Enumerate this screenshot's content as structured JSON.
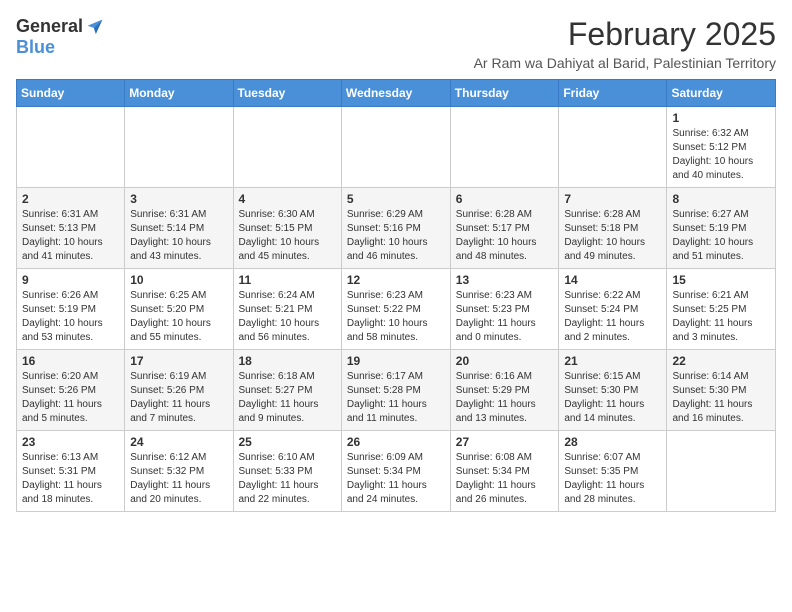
{
  "header": {
    "logo_general": "General",
    "logo_blue": "Blue",
    "month_title": "February 2025",
    "location": "Ar Ram wa Dahiyat al Barid, Palestinian Territory"
  },
  "days_of_week": [
    "Sunday",
    "Monday",
    "Tuesday",
    "Wednesday",
    "Thursday",
    "Friday",
    "Saturday"
  ],
  "weeks": [
    [
      {
        "day": "",
        "info": ""
      },
      {
        "day": "",
        "info": ""
      },
      {
        "day": "",
        "info": ""
      },
      {
        "day": "",
        "info": ""
      },
      {
        "day": "",
        "info": ""
      },
      {
        "day": "",
        "info": ""
      },
      {
        "day": "1",
        "info": "Sunrise: 6:32 AM\nSunset: 5:12 PM\nDaylight: 10 hours and 40 minutes."
      }
    ],
    [
      {
        "day": "2",
        "info": "Sunrise: 6:31 AM\nSunset: 5:13 PM\nDaylight: 10 hours and 41 minutes."
      },
      {
        "day": "3",
        "info": "Sunrise: 6:31 AM\nSunset: 5:14 PM\nDaylight: 10 hours and 43 minutes."
      },
      {
        "day": "4",
        "info": "Sunrise: 6:30 AM\nSunset: 5:15 PM\nDaylight: 10 hours and 45 minutes."
      },
      {
        "day": "5",
        "info": "Sunrise: 6:29 AM\nSunset: 5:16 PM\nDaylight: 10 hours and 46 minutes."
      },
      {
        "day": "6",
        "info": "Sunrise: 6:28 AM\nSunset: 5:17 PM\nDaylight: 10 hours and 48 minutes."
      },
      {
        "day": "7",
        "info": "Sunrise: 6:28 AM\nSunset: 5:18 PM\nDaylight: 10 hours and 49 minutes."
      },
      {
        "day": "8",
        "info": "Sunrise: 6:27 AM\nSunset: 5:19 PM\nDaylight: 10 hours and 51 minutes."
      }
    ],
    [
      {
        "day": "9",
        "info": "Sunrise: 6:26 AM\nSunset: 5:19 PM\nDaylight: 10 hours and 53 minutes."
      },
      {
        "day": "10",
        "info": "Sunrise: 6:25 AM\nSunset: 5:20 PM\nDaylight: 10 hours and 55 minutes."
      },
      {
        "day": "11",
        "info": "Sunrise: 6:24 AM\nSunset: 5:21 PM\nDaylight: 10 hours and 56 minutes."
      },
      {
        "day": "12",
        "info": "Sunrise: 6:23 AM\nSunset: 5:22 PM\nDaylight: 10 hours and 58 minutes."
      },
      {
        "day": "13",
        "info": "Sunrise: 6:23 AM\nSunset: 5:23 PM\nDaylight: 11 hours and 0 minutes."
      },
      {
        "day": "14",
        "info": "Sunrise: 6:22 AM\nSunset: 5:24 PM\nDaylight: 11 hours and 2 minutes."
      },
      {
        "day": "15",
        "info": "Sunrise: 6:21 AM\nSunset: 5:25 PM\nDaylight: 11 hours and 3 minutes."
      }
    ],
    [
      {
        "day": "16",
        "info": "Sunrise: 6:20 AM\nSunset: 5:26 PM\nDaylight: 11 hours and 5 minutes."
      },
      {
        "day": "17",
        "info": "Sunrise: 6:19 AM\nSunset: 5:26 PM\nDaylight: 11 hours and 7 minutes."
      },
      {
        "day": "18",
        "info": "Sunrise: 6:18 AM\nSunset: 5:27 PM\nDaylight: 11 hours and 9 minutes."
      },
      {
        "day": "19",
        "info": "Sunrise: 6:17 AM\nSunset: 5:28 PM\nDaylight: 11 hours and 11 minutes."
      },
      {
        "day": "20",
        "info": "Sunrise: 6:16 AM\nSunset: 5:29 PM\nDaylight: 11 hours and 13 minutes."
      },
      {
        "day": "21",
        "info": "Sunrise: 6:15 AM\nSunset: 5:30 PM\nDaylight: 11 hours and 14 minutes."
      },
      {
        "day": "22",
        "info": "Sunrise: 6:14 AM\nSunset: 5:30 PM\nDaylight: 11 hours and 16 minutes."
      }
    ],
    [
      {
        "day": "23",
        "info": "Sunrise: 6:13 AM\nSunset: 5:31 PM\nDaylight: 11 hours and 18 minutes."
      },
      {
        "day": "24",
        "info": "Sunrise: 6:12 AM\nSunset: 5:32 PM\nDaylight: 11 hours and 20 minutes."
      },
      {
        "day": "25",
        "info": "Sunrise: 6:10 AM\nSunset: 5:33 PM\nDaylight: 11 hours and 22 minutes."
      },
      {
        "day": "26",
        "info": "Sunrise: 6:09 AM\nSunset: 5:34 PM\nDaylight: 11 hours and 24 minutes."
      },
      {
        "day": "27",
        "info": "Sunrise: 6:08 AM\nSunset: 5:34 PM\nDaylight: 11 hours and 26 minutes."
      },
      {
        "day": "28",
        "info": "Sunrise: 6:07 AM\nSunset: 5:35 PM\nDaylight: 11 hours and 28 minutes."
      },
      {
        "day": "",
        "info": ""
      }
    ]
  ]
}
